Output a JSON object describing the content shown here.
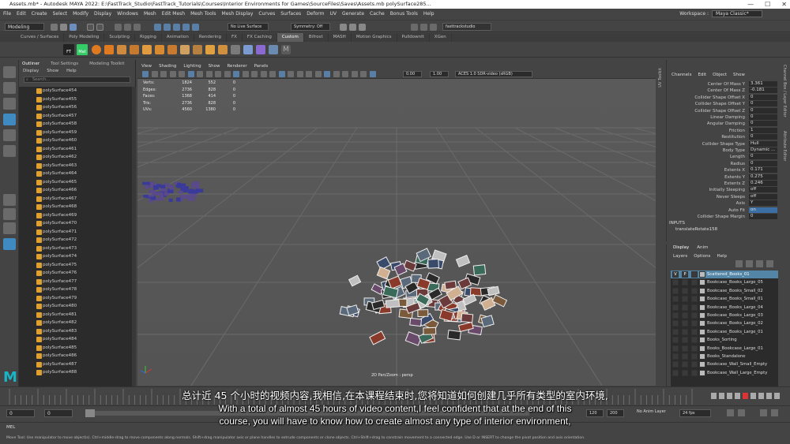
{
  "titlebar": {
    "text": "Assets.mb* - Autodesk MAYA 2022: E:\\FastTrack_Studio\\FastTrack_Tutorials\\Courses\\Interior Environments for Games\\SourceFiles\\Saves\\Assets.mb    polySurface285...",
    "minimize": "—",
    "maximize": "☐",
    "close": "✕"
  },
  "menubar": {
    "items": [
      "File",
      "Edit",
      "Create",
      "Select",
      "Modify",
      "Display",
      "Windows",
      "Mesh",
      "Edit Mesh",
      "Mesh Tools",
      "Mesh Display",
      "Curves",
      "Surfaces",
      "Deform",
      "UV",
      "Generate",
      "Cache",
      "Bonus Tools",
      "Help"
    ],
    "workspace_label": "Workspace :",
    "workspace_value": "Maya Classic*"
  },
  "statusline": {
    "mode": "Modeling",
    "live_surface": "No Live Surface",
    "symmetry": "Symmetry: Off",
    "project": "fasttrackstudio"
  },
  "shelf": {
    "tabs": [
      "Curves / Surfaces",
      "Poly Modeling",
      "Sculpting",
      "Rigging",
      "Animation",
      "Rendering",
      "FX",
      "FX Caching",
      "Custom",
      "Bifrost",
      "MASH",
      "Motion Graphics",
      "Pulldownlt",
      "XGen"
    ],
    "active_tab": "Custom",
    "btn_ft": "FT",
    "btn_mat": "Mat"
  },
  "outliner": {
    "tabs": [
      "Outliner",
      "Tool Settings",
      "Modeling Toolkit"
    ],
    "menu": [
      "Display",
      "Show",
      "Help"
    ],
    "search_placeholder": "Search...",
    "items": [
      "polySurface454",
      "polySurface455",
      "polySurface456",
      "polySurface457",
      "polySurface458",
      "polySurface459",
      "polySurface460",
      "polySurface461",
      "polySurface462",
      "polySurface463",
      "polySurface464",
      "polySurface465",
      "polySurface466",
      "polySurface467",
      "polySurface468",
      "polySurface469",
      "polySurface470",
      "polySurface471",
      "polySurface472",
      "polySurface473",
      "polySurface474",
      "polySurface475",
      "polySurface476",
      "polySurface477",
      "polySurface478",
      "polySurface479",
      "polySurface480",
      "polySurface481",
      "polySurface482",
      "polySurface483",
      "polySurface484",
      "polySurface485",
      "polySurface486",
      "polySurface487",
      "polySurface488"
    ]
  },
  "viewport": {
    "menu": [
      "View",
      "Shading",
      "Lighting",
      "Show",
      "Renderer",
      "Panels"
    ],
    "exposure": "0.00",
    "gamma": "1.00",
    "color_space": "ACES 1.0 SDR-video (sRGB)",
    "hud": [
      {
        "k": "Verts:",
        "a": "1824",
        "b": "552",
        "c": "0"
      },
      {
        "k": "Edges:",
        "a": "2736",
        "b": "828",
        "c": "0"
      },
      {
        "k": "Faces:",
        "a": "1368",
        "b": "414",
        "c": "0"
      },
      {
        "k": "Tris:",
        "a": "2736",
        "b": "828",
        "c": "0"
      },
      {
        "k": "UVs:",
        "a": "4560",
        "b": "1380",
        "c": "0"
      }
    ],
    "camera_label": "2D Pan/Zoom : persp",
    "side_label": "UV Toolkit"
  },
  "channelbox": {
    "tabs": [
      "Channels",
      "Edit",
      "Object",
      "Show"
    ],
    "attributes": [
      {
        "n": "Center Of Mass Y",
        "v": "3.361"
      },
      {
        "n": "Center Of Mass Z",
        "v": "-0.181"
      },
      {
        "n": "Collider Shape Offset X",
        "v": "0"
      },
      {
        "n": "Collider Shape Offset Y",
        "v": "0"
      },
      {
        "n": "Collider Shape Offset Z",
        "v": "0"
      },
      {
        "n": "Linear Damping",
        "v": "0"
      },
      {
        "n": "Angular Damping",
        "v": "0"
      },
      {
        "n": "Friction",
        "v": "1"
      },
      {
        "n": "Restitution",
        "v": "0"
      },
      {
        "n": "Collider Shape Type",
        "v": "Hull"
      },
      {
        "n": "Body Type",
        "v": "Dynamic ..."
      },
      {
        "n": "Length",
        "v": "0"
      },
      {
        "n": "Radius",
        "v": "0"
      },
      {
        "n": "Extents X",
        "v": "0.171"
      },
      {
        "n": "Extents Y",
        "v": "0.275"
      },
      {
        "n": "Extents Z",
        "v": "0.246"
      },
      {
        "n": "Initially Sleeping",
        "v": "off"
      },
      {
        "n": "Never Sleeps",
        "v": "off"
      },
      {
        "n": "Axis",
        "v": "Y"
      },
      {
        "n": "Auto Fit",
        "v": "on"
      },
      {
        "n": "Collider Shape Margin",
        "v": "0"
      }
    ],
    "inputs_label": "INPUTS",
    "inputs_node": "translateRotate158",
    "side_labels": [
      "Channel Box / Layer Editor",
      "Attribute Editor"
    ]
  },
  "layers": {
    "tabs": [
      "Display",
      "Anim"
    ],
    "menu": [
      "Layers",
      "Options",
      "Help"
    ],
    "items": [
      "Scattered_Books_01",
      "Bookcase_Books_Large_05",
      "Bookcase_Books_Small_02",
      "Bookcase_Books_Small_01",
      "Bookcase_Books_Large_04",
      "Bookcase_Books_Large_03",
      "Bookcase_Books_Large_02",
      "Bookcase_Books_Large_01",
      "Books_Sorting",
      "Books_Bookcase_Large_01",
      "Books_Standalone",
      "Bookcase_Wall_Small_Empty",
      "Bookcase_Wall_Large_Empty"
    ],
    "selected": "Scattered_Books_01",
    "v": "V",
    "p": "P"
  },
  "timeline": {
    "start_a": "0",
    "start_b": "0",
    "end_a": "120",
    "end_b": "200",
    "anim_layer": "No Anim Layer",
    "fps": "24 fps"
  },
  "mel": {
    "label": "MEL"
  },
  "helpline": "Move Tool: Use manipulator to move object(s). Ctrl+middle-drag to move components along normals. Shift+drag manipulator axis or plane handles to extrude components or clone objects. Ctrl+Shift+drag to constrain movement to a connected edge. Use D or INSERT to change the pivot position and axis orientation.",
  "subtitles": {
    "zh": "总计近 45 个小时的视频内容,我相信,在本课程结束时,您将知道如何创建几乎所有类型的室内环境,",
    "en_line1": "With a total of almost 45 hours of video content,I feel confident that at the end of this",
    "en_line2": "course, you will have to know how to create almost any type of interior environment,"
  },
  "logo": "M"
}
